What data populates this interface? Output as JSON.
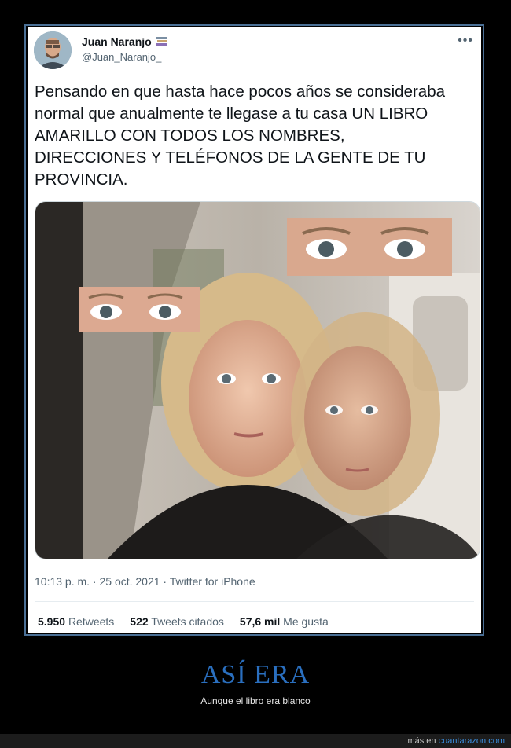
{
  "tweet": {
    "author_name": "Juan Naranjo",
    "author_handle": "@Juan_Naranjo_",
    "text": "Pensando en que hasta hace pocos años se consideraba normal que anualmente te llegase a tu casa UN LIBRO AMARILLO CON TODOS LOS NOMBRES, DIRECCIONES Y TELÉFONOS DE LA GENTE DE TU PROVINCIA.",
    "timestamp": "10:13 p. m. · 25 oct. 2021 · Twitter for iPhone",
    "stats": {
      "retweets_count": "5.950",
      "retweets_label": "Retweets",
      "quotes_count": "522",
      "quotes_label": "Tweets citados",
      "likes_count": "57,6 mil",
      "likes_label": "Me gusta"
    },
    "icons": {
      "more": "more-options-icon",
      "badge": "books-icon"
    }
  },
  "caption": {
    "title": "ASÍ ERA",
    "subtitle": "Aunque el libro era blanco"
  },
  "footer": {
    "prefix": "más en",
    "site": "cuantarazon.com"
  },
  "colors": {
    "frame_border": "#4a6f95",
    "caption_title": "#2a6fbf",
    "footer_link": "#3b8fe0"
  }
}
